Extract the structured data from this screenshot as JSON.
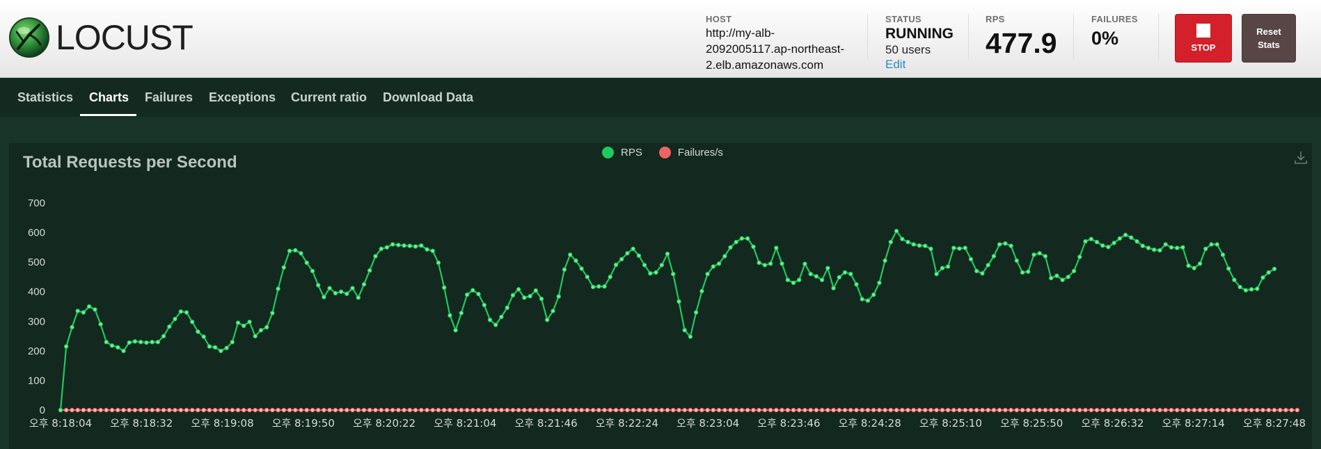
{
  "app": {
    "name": "LOCUST"
  },
  "header": {
    "host_label": "HOST",
    "host_lines": [
      "http://my-alb-",
      "2092005117.ap-northeast-",
      "2.elb.amazonaws.com"
    ],
    "status_label": "STATUS",
    "status_value": "RUNNING",
    "users": "50 users",
    "edit_label": "Edit",
    "rps_label": "RPS",
    "rps_value": "477.9",
    "failures_label": "FAILURES",
    "failures_value": "0%",
    "stop_label": "STOP",
    "reset_label_1": "Reset",
    "reset_label_2": "Stats"
  },
  "tabs": [
    {
      "label": "Statistics",
      "active": false
    },
    {
      "label": "Charts",
      "active": true
    },
    {
      "label": "Failures",
      "active": false
    },
    {
      "label": "Exceptions",
      "active": false
    },
    {
      "label": "Current ratio",
      "active": false
    },
    {
      "label": "Download Data",
      "active": false
    }
  ],
  "colors": {
    "rps_line": "#1fcb5c",
    "rps_point_fill": "#7fe79f",
    "failures_line": "#f06464",
    "failures_point_fill": "#ffc3c3",
    "stop_button": "#d3202a",
    "reset_button": "#584646",
    "edit_link": "#2e87c6",
    "axis_text": "#d6ddd9"
  },
  "icons": {
    "download": "download-icon",
    "stop": "stop-square-icon",
    "logo": "locust-logo-icon"
  },
  "chart_data": {
    "type": "line",
    "title": "Total Requests per Second",
    "legend": [
      "RPS",
      "Failures/s"
    ],
    "legend_placement": "top-center",
    "ylim": [
      0,
      700
    ],
    "yticks": [
      0,
      100,
      200,
      300,
      400,
      500,
      600,
      700
    ],
    "grid": false,
    "xtick_labels": [
      "오후 8:18:04",
      "오후 8:18:32",
      "오후 8:19:08",
      "오후 8:19:50",
      "오후 8:20:22",
      "오후 8:21:04",
      "오후 8:21:46",
      "오후 8:22:24",
      "오후 8:23:04",
      "오후 8:23:46",
      "오후 8:24:28",
      "오후 8:25:10",
      "오후 8:25:50",
      "오후 8:26:32",
      "오후 8:27:14",
      "오후 8:27:48"
    ],
    "series": [
      {
        "name": "RPS",
        "values": [
          0,
          215,
          280,
          335,
          330,
          350,
          340,
          290,
          230,
          218,
          212,
          200,
          228,
          232,
          230,
          228,
          230,
          230,
          250,
          282,
          308,
          333,
          330,
          298,
          265,
          248,
          215,
          212,
          200,
          210,
          230,
          295,
          285,
          298,
          250,
          270,
          280,
          328,
          410,
          482,
          538,
          540,
          530,
          498,
          470,
          422,
          382,
          412,
          395,
          400,
          393,
          412,
          380,
          425,
          472,
          520,
          545,
          550,
          560,
          558,
          556,
          555,
          553,
          556,
          543,
          538,
          498,
          414,
          320,
          270,
          328,
          390,
          405,
          392,
          355,
          305,
          288,
          315,
          346,
          388,
          408,
          380,
          385,
          404,
          376,
          305,
          335,
          384,
          475,
          525,
          505,
          478,
          450,
          416,
          418,
          418,
          450,
          491,
          510,
          530,
          545,
          522,
          490,
          462,
          465,
          490,
          528,
          460,
          367,
          270,
          248,
          330,
          402,
          460,
          485,
          495,
          520,
          550,
          568,
          580,
          580,
          552,
          498,
          490,
          495,
          548,
          495,
          440,
          430,
          440,
          494,
          460,
          452,
          440,
          480,
          412,
          449,
          465,
          460,
          425,
          375,
          370,
          390,
          430,
          505,
          568,
          605,
          578,
          568,
          560,
          556,
          555,
          545,
          460,
          480,
          485,
          548,
          546,
          548,
          510,
          470,
          462,
          490,
          520,
          560,
          563,
          555,
          505,
          465,
          468,
          525,
          530,
          520,
          446,
          454,
          440,
          450,
          470,
          518,
          570,
          578,
          568,
          556,
          551,
          565,
          580,
          592,
          583,
          570,
          555,
          548,
          542,
          540,
          560,
          550,
          548,
          550,
          488,
          480,
          495,
          545,
          560,
          560,
          525,
          478,
          440,
          416,
          405,
          408,
          410,
          448,
          465,
          477
        ]
      },
      {
        "name": "Failures/s",
        "values": [
          0,
          0,
          0,
          0,
          0,
          0,
          0,
          0,
          0,
          0,
          0,
          0,
          0,
          0,
          0,
          0,
          0,
          0,
          0,
          0,
          0,
          0,
          0,
          0,
          0,
          0,
          0,
          0,
          0,
          0,
          0,
          0,
          0,
          0,
          0,
          0,
          0,
          0,
          0,
          0,
          0,
          0,
          0,
          0,
          0,
          0,
          0,
          0,
          0,
          0,
          0,
          0,
          0,
          0,
          0,
          0,
          0,
          0,
          0,
          0,
          0,
          0,
          0,
          0,
          0,
          0,
          0,
          0,
          0,
          0,
          0,
          0,
          0,
          0,
          0,
          0,
          0,
          0,
          0,
          0,
          0,
          0,
          0,
          0,
          0,
          0,
          0,
          0,
          0,
          0,
          0,
          0,
          0,
          0,
          0,
          0,
          0,
          0,
          0,
          0,
          0,
          0,
          0,
          0,
          0,
          0,
          0,
          0,
          0,
          0,
          0,
          0,
          0,
          0,
          0,
          0,
          0,
          0,
          0,
          0,
          0,
          0,
          0,
          0,
          0,
          0,
          0,
          0,
          0,
          0,
          0,
          0,
          0,
          0,
          0,
          0,
          0,
          0,
          0,
          0,
          0,
          0,
          0,
          0,
          0,
          0,
          0,
          0,
          0,
          0,
          0,
          0,
          0,
          0,
          0,
          0,
          0,
          0,
          0,
          0,
          0,
          0,
          0,
          0,
          0,
          0,
          0,
          0,
          0,
          0,
          0,
          0,
          0,
          0,
          0,
          0,
          0,
          0,
          0,
          0,
          0,
          0,
          0,
          0,
          0,
          0,
          0,
          0,
          0,
          0,
          0,
          0,
          0,
          0,
          0,
          0,
          0,
          0,
          0,
          0,
          0,
          0,
          0,
          0,
          0,
          0,
          0,
          0,
          0,
          0,
          0,
          0,
          0,
          0,
          0,
          0,
          0
        ]
      }
    ]
  }
}
